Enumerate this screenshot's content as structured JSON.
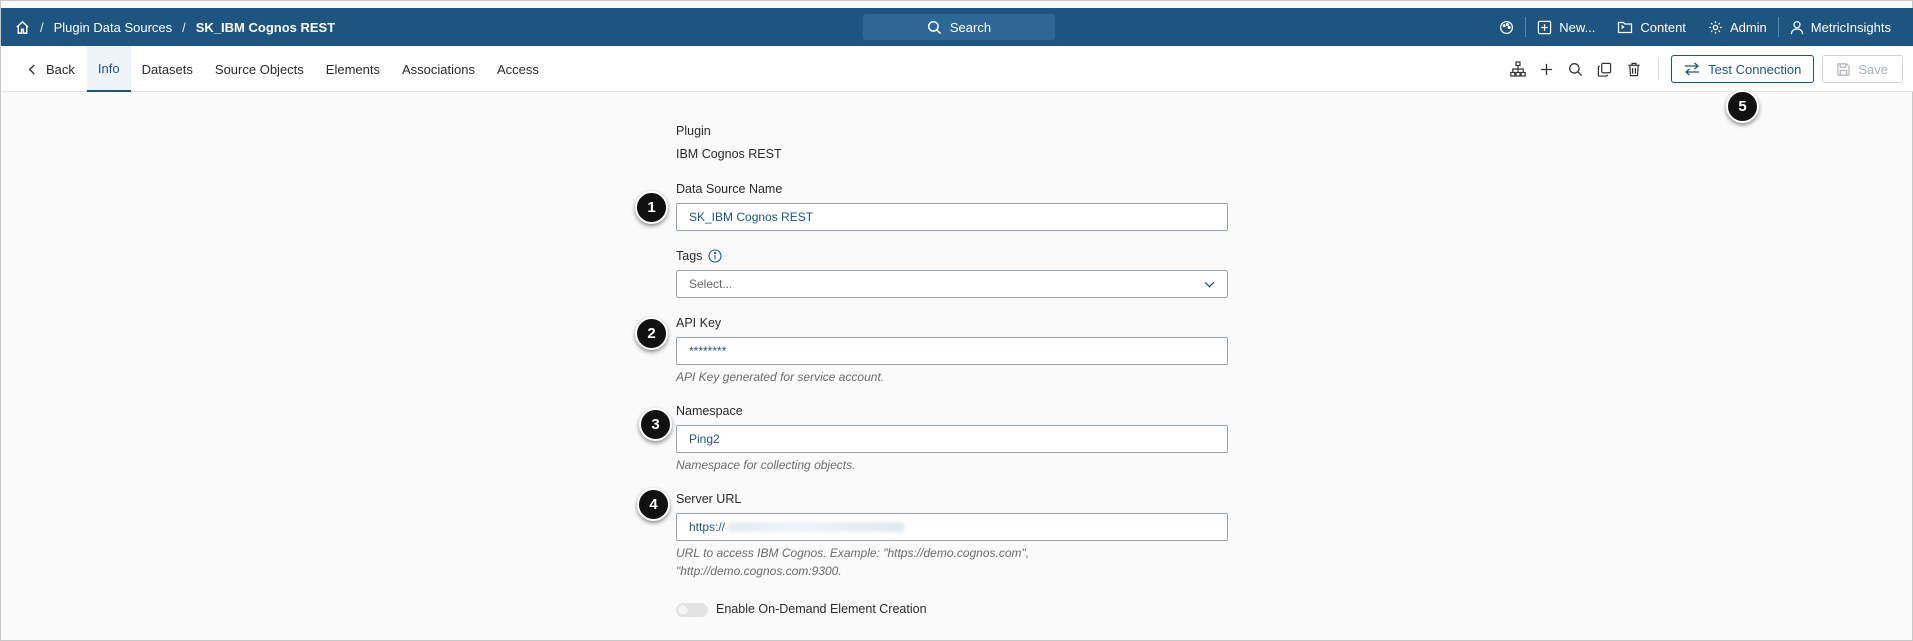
{
  "breadcrumb": {
    "items": [
      "Plugin Data Sources",
      "SK_IBM Cognos REST"
    ],
    "separator": "/"
  },
  "search": {
    "label": "Search"
  },
  "top_actions": {
    "new_label": "New...",
    "content_label": "Content",
    "admin_label": "Admin",
    "user_label": "MetricInsights"
  },
  "tabs": {
    "back": "Back",
    "items": [
      "Info",
      "Datasets",
      "Source Objects",
      "Elements",
      "Associations",
      "Access"
    ],
    "active": "Info"
  },
  "toolbar": {
    "test_connection_label": "Test Connection",
    "save_label": "Save"
  },
  "form": {
    "plugin_label": "Plugin",
    "plugin_value": "IBM Cognos REST",
    "name_label": "Data Source Name",
    "name_value": "SK_IBM Cognos REST",
    "tags_label": "Tags",
    "tags_placeholder": "Select...",
    "api_key_label": "API Key",
    "api_key_value": "********",
    "api_key_hint": "API Key generated for service account.",
    "namespace_label": "Namespace",
    "namespace_value": "Ping2",
    "namespace_hint": "Namespace for collecting objects.",
    "server_url_label": "Server URL",
    "server_url_value": "https://",
    "server_url_hint": "URL to access IBM Cognos. Example: \"https://demo.cognos.com\", \"http://demo.cognos.com:9300.",
    "on_demand_label": "Enable On-Demand Element Creation",
    "on_demand_enabled": false
  },
  "callouts": [
    "1",
    "2",
    "3",
    "4",
    "5"
  ],
  "colors": {
    "brand": "#1d5480",
    "accent": "#1d5480"
  }
}
